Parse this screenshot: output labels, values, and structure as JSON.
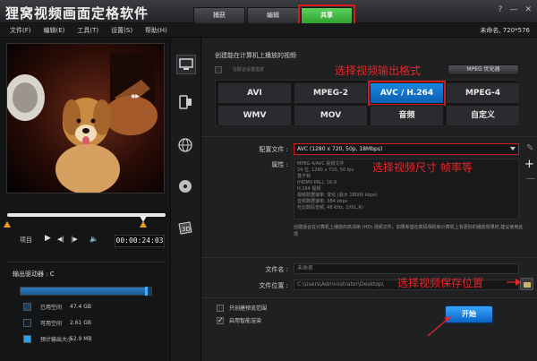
{
  "app": {
    "title": "狸窝视频画面定格软件"
  },
  "tabs": [
    {
      "label": "捕获"
    },
    {
      "label": "编辑"
    },
    {
      "label": "共享"
    }
  ],
  "window_controls": {
    "help": "?",
    "minimize": "—",
    "close": "✕"
  },
  "menu": [
    {
      "label": "文件(F)"
    },
    {
      "label": "编辑(E)"
    },
    {
      "label": "工具(T)"
    },
    {
      "label": "设置(S)"
    },
    {
      "label": "帮助(H)"
    }
  ],
  "project": {
    "name": "未命名, 720*576"
  },
  "player": {
    "items_label": "项目",
    "timecode": "00:00:24:03",
    "controls": {
      "play": "▶",
      "prev_frame": "◀|",
      "next_frame": "|▶"
    }
  },
  "drive": {
    "label": "输出驱动器 : C",
    "used_fraction": 0.95,
    "legend": [
      {
        "label": "已用空间",
        "value": "47.4 GB",
        "color": "#1a3f66"
      },
      {
        "label": "可用空间",
        "value": "2.61 GB",
        "color": "#0f2233"
      },
      {
        "label": "预计输出大小",
        "value": "52.9 MB",
        "color": "#1aa3ff"
      }
    ]
  },
  "share": {
    "section_title": "创建能在计算机上播放的视频",
    "upload_option": "在联合设置指定",
    "mpeg_optimizer": "MPEG 优化器",
    "formats": [
      {
        "label": "AVI",
        "selected": false
      },
      {
        "label": "MPEG-2",
        "selected": false
      },
      {
        "label": "AVC / H.264",
        "selected": true
      },
      {
        "label": "MPEG-4",
        "selected": false
      },
      {
        "label": "WMV",
        "selected": false
      },
      {
        "label": "MOV",
        "selected": false
      },
      {
        "label": "音频",
        "selected": false
      },
      {
        "label": "自定义",
        "selected": false
      }
    ],
    "profile_label": "配置文件 :",
    "profile_value": "AVC (1280 x 720, 50p, 18Mbps)",
    "props_label": "属性 :",
    "properties": [
      "MPEG 4/AVC 视频文件",
      "24 位, 1280 x 720, 50 fps",
      "基于帧",
      "(HDMV-PAL), 16:9",
      "H.264 视频",
      "视频数据速率: 变化 (最大 18000 kbps)",
      "音频数据速率: 384 kbps",
      "杜比数码音频, 48 KHz, 2/0(L,R)"
    ],
    "description": "创建适合在计算机上播放的高清晰 (HD) 视频文件。如果希望在数码相机和计算机上有更好的播放效果时,建议使用此项",
    "filename_label": "文件名 :",
    "filename_value": "未命名",
    "location_label": "文件位置 :",
    "location_value": "C:\\Users\\Administrator\\Desktop\\",
    "checkbox_preview_only": "只创建预览范围",
    "checkbox_smart_render": "启用智能渲染",
    "start_button": "开始"
  },
  "annotations": {
    "format": "选择视频输出格式",
    "size": "选择视频尺寸  帧率等",
    "location": "选择视频保存位置"
  },
  "colors": {
    "accent_blue": "#1a87e0",
    "active_tab": "#2fa02f",
    "annotation_red": "#e8262a"
  }
}
